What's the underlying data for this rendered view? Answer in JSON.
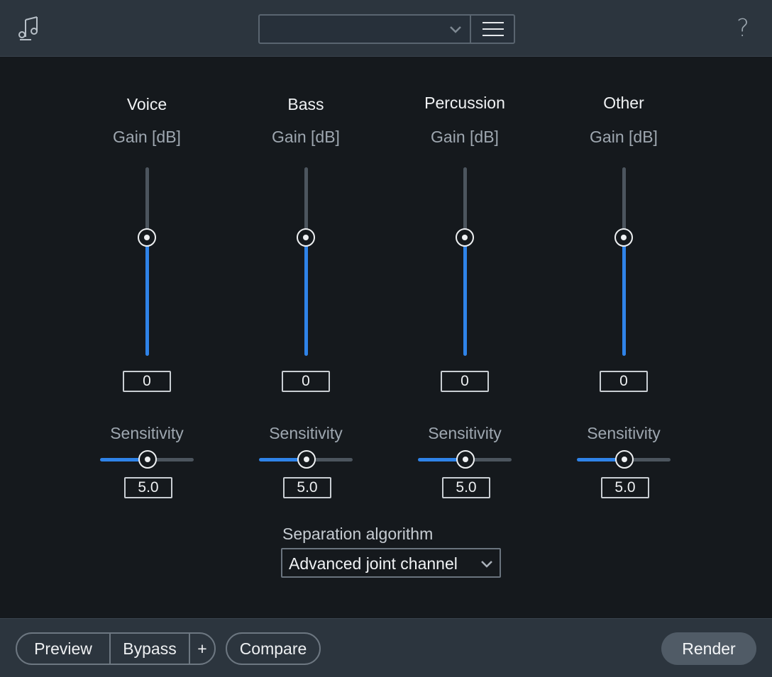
{
  "header": {
    "logo_icon": "music-notes-icon",
    "preset_value": "",
    "preset_chevron_icon": "chevron-down-icon",
    "menu_icon": "hamburger-menu-icon",
    "help_label": "?"
  },
  "channels": [
    {
      "title": "Voice",
      "gain_label": "Gain [dB]",
      "gain_value": "0",
      "sensitivity_label": "Sensitivity",
      "sensitivity_value": "5.0"
    },
    {
      "title": "Bass",
      "gain_label": "Gain [dB]",
      "gain_value": "0",
      "sensitivity_label": "Sensitivity",
      "sensitivity_value": "5.0"
    },
    {
      "title": "Percussion",
      "gain_label": "Gain [dB]",
      "gain_value": "0",
      "sensitivity_label": "Sensitivity",
      "sensitivity_value": "5.0"
    },
    {
      "title": "Other",
      "gain_label": "Gain [dB]",
      "gain_value": "0",
      "sensitivity_label": "Sensitivity",
      "sensitivity_value": "5.0"
    }
  ],
  "separation": {
    "label": "Separation algorithm",
    "value": "Advanced joint channel"
  },
  "footer": {
    "preview": "Preview",
    "bypass": "Bypass",
    "plus": "+",
    "compare": "Compare",
    "render": "Render"
  },
  "colors": {
    "accent": "#2f83e8",
    "panel": "#2c353e",
    "background": "#15191d"
  }
}
